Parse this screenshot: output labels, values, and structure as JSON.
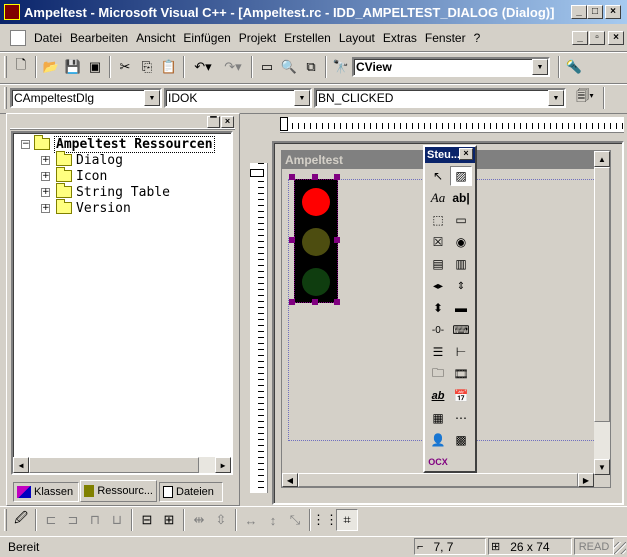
{
  "window": {
    "title": "Ampeltest - Microsoft Visual C++ - [Ampeltest.rc - IDD_AMPELTEST_DIALOG (Dialog)]",
    "buttons": {
      "minimize": "_",
      "maximize": "□",
      "close": "×"
    }
  },
  "menu": [
    {
      "label": "Datei"
    },
    {
      "label": "Bearbeiten"
    },
    {
      "label": "Ansicht"
    },
    {
      "label": "Einfügen"
    },
    {
      "label": "Projekt"
    },
    {
      "label": "Erstellen"
    },
    {
      "label": "Layout"
    },
    {
      "label": "Extras"
    },
    {
      "label": "Fenster"
    },
    {
      "label": "?"
    }
  ],
  "toolbar": {
    "find_combo_value": "CView"
  },
  "wizardbar": {
    "class_value": "CAmpeltestDlg",
    "id_value": "IDOK",
    "message_value": "BN_CLICKED"
  },
  "workspace": {
    "tree_root": "Ampeltest Ressourcen",
    "tree_items": [
      "Dialog",
      "Icon",
      "String Table",
      "Version"
    ],
    "tabs": [
      "Klassen",
      "Ressourc...",
      "Dateien"
    ]
  },
  "editor": {
    "dialog_title": "Ampeltest",
    "toolbox_title": "Steu...",
    "toolbox_ocx_label": "OCX",
    "traffic_light": {
      "red": "#ff0000",
      "yellow_off": "#4d4d10",
      "green_off": "#0f3d0f"
    }
  },
  "statusbar": {
    "text": "Bereit",
    "position": "7, 7",
    "size": "26 x 74",
    "read": "READ"
  },
  "colors": {
    "titlebar_start": "#0a246a",
    "titlebar_end": "#a6caf0",
    "face": "#d4d0c8"
  }
}
